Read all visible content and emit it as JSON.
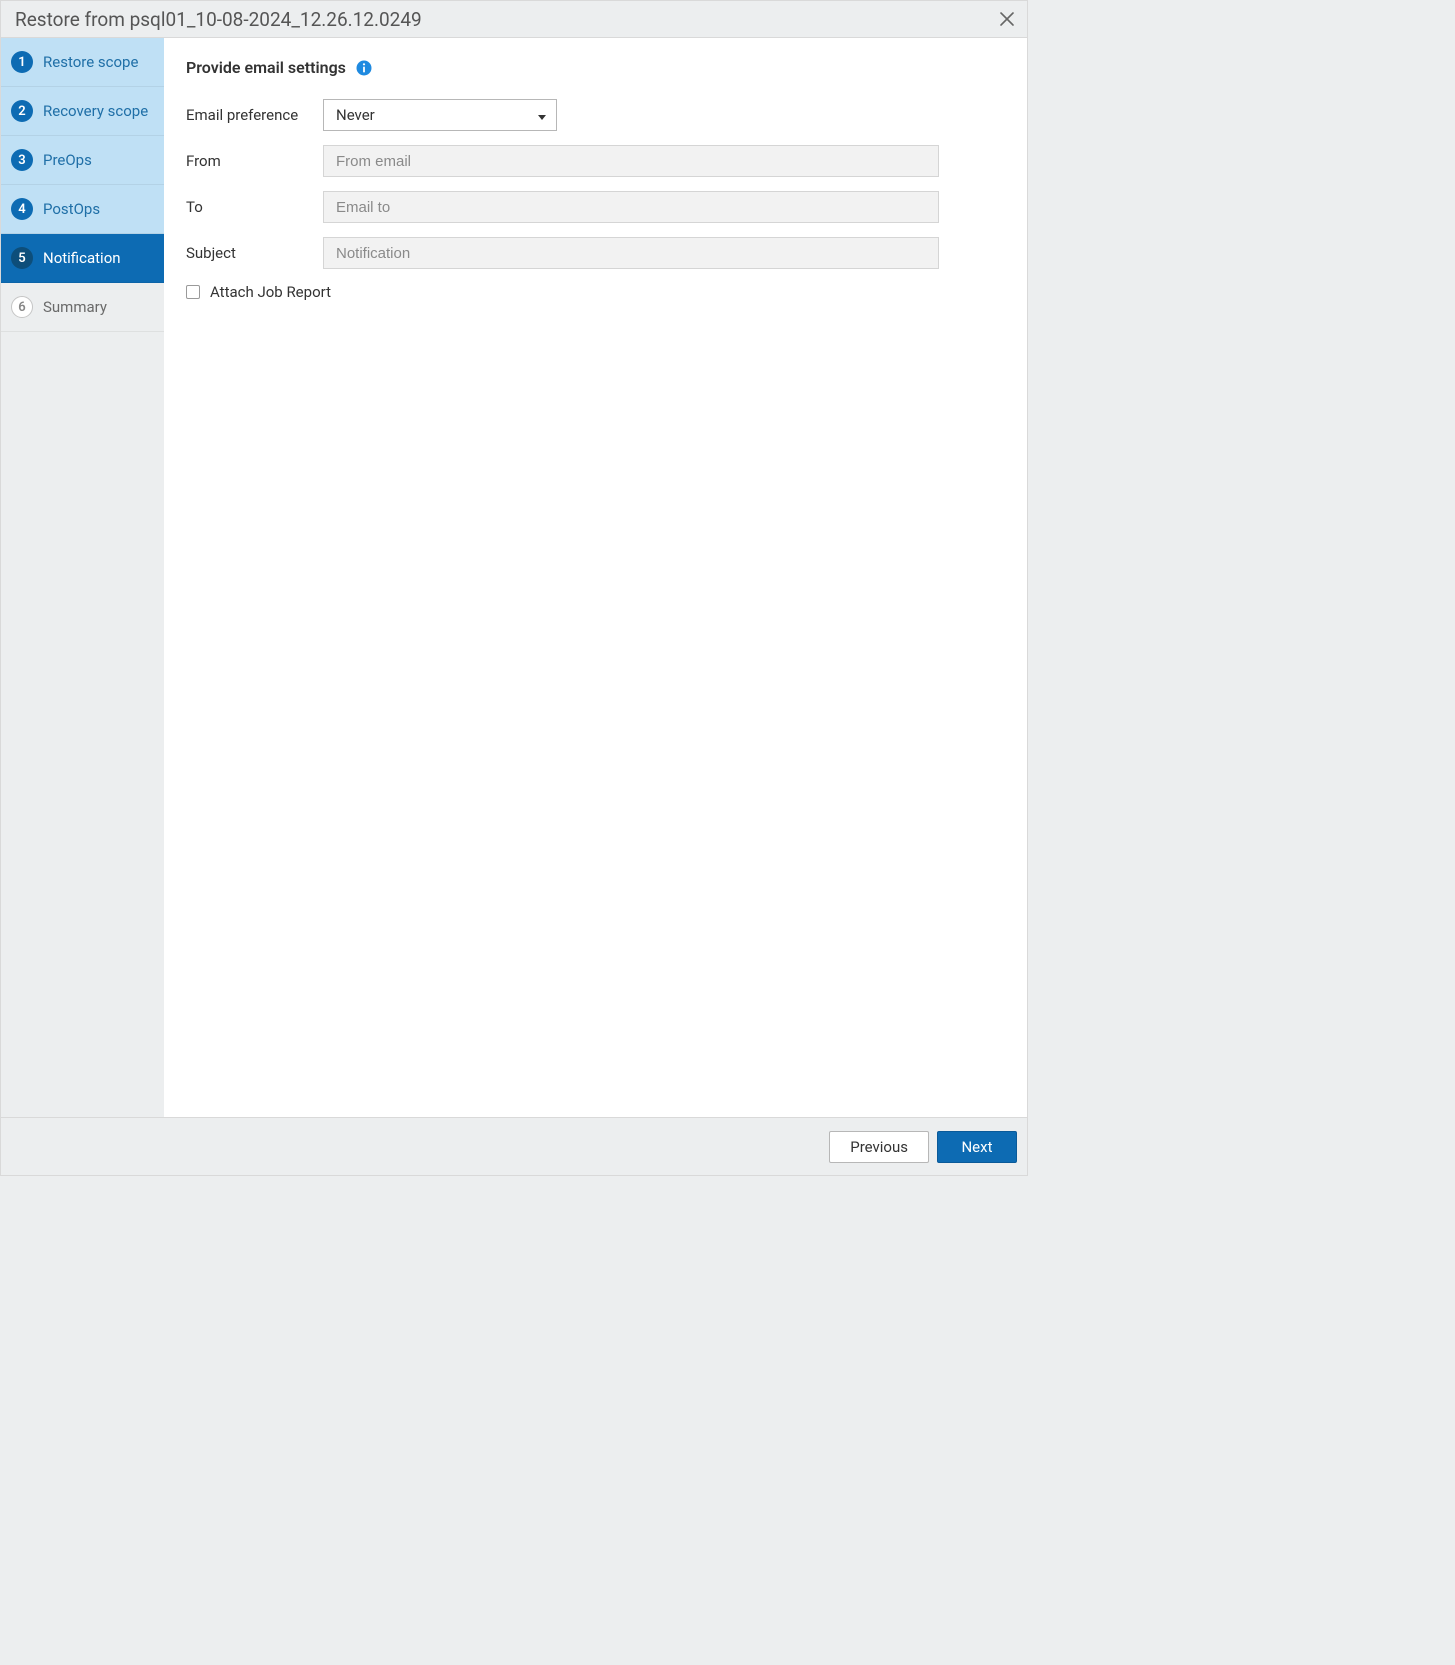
{
  "titlebar": {
    "title": "Restore from psql01_10-08-2024_12.26.12.0249"
  },
  "sidebar": {
    "steps": [
      {
        "num": "1",
        "label": "Restore scope",
        "state": "completed"
      },
      {
        "num": "2",
        "label": "Recovery scope",
        "state": "completed"
      },
      {
        "num": "3",
        "label": "PreOps",
        "state": "completed"
      },
      {
        "num": "4",
        "label": "PostOps",
        "state": "completed"
      },
      {
        "num": "5",
        "label": "Notification",
        "state": "active"
      },
      {
        "num": "6",
        "label": "Summary",
        "state": "upcoming"
      }
    ]
  },
  "content": {
    "heading": "Provide email settings",
    "labels": {
      "email_preference": "Email preference",
      "from": "From",
      "to": "To",
      "subject": "Subject",
      "attach_job_report": "Attach Job Report"
    },
    "values": {
      "email_preference_selected": "Never",
      "from": "",
      "to": "",
      "subject": ""
    },
    "placeholders": {
      "from": "From email",
      "to": "Email to",
      "subject": "Notification"
    },
    "attach_job_report_checked": false
  },
  "footer": {
    "previous": "Previous",
    "next": "Next"
  },
  "icons": {
    "close": "close-icon",
    "info": "info-icon",
    "caret": "chevron-down-icon"
  }
}
